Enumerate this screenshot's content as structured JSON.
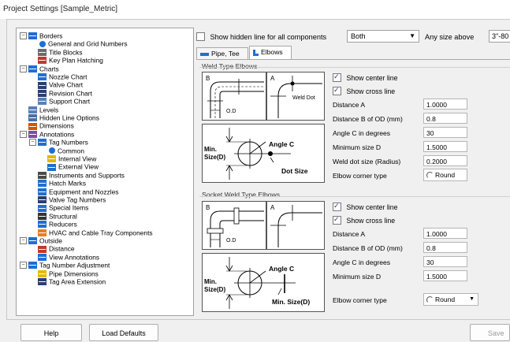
{
  "window": {
    "title": "Project Settings [Sample_Metric]"
  },
  "toolbar": {
    "show_hidden_label": "Show hidden line for all components",
    "show_hidden_checked": false,
    "hidden_select_value": "Both",
    "any_size_label": "Any size above",
    "any_size_value": "3\"-80"
  },
  "tabs": [
    {
      "label": "Pipe, Tee",
      "active": false
    },
    {
      "label": "Elbows",
      "active": true
    }
  ],
  "tree": [
    {
      "label": "Borders",
      "icon": "borders-icon",
      "exp": "−"
    },
    {
      "label": "General and Grid Numbers",
      "icon": "circle-icon"
    },
    {
      "label": "Title Blocks",
      "icon": "title-blocks-icon"
    },
    {
      "label": "Key Plan Hatching",
      "icon": "key-plan-icon"
    },
    {
      "label": "Charts",
      "icon": "charts-icon",
      "exp": "−"
    },
    {
      "label": "Nozzle Chart",
      "icon": "nozzle-chart-icon"
    },
    {
      "label": "Valve Chart",
      "icon": "valve-chart-icon"
    },
    {
      "label": "Revision Chart",
      "icon": "revision-chart-icon"
    },
    {
      "label": "Support Chart",
      "icon": "support-chart-icon"
    },
    {
      "label": "Levels",
      "icon": "levels-icon"
    },
    {
      "label": "Hidden Line Options",
      "icon": "hidden-line-icon"
    },
    {
      "label": "Dimensions",
      "icon": "dimensions-icon"
    },
    {
      "label": "Annotations",
      "icon": "annotations-icon",
      "exp": "−"
    },
    {
      "label": "Tag Numbers",
      "icon": "tag-icon",
      "exp": "−"
    },
    {
      "label": "Common",
      "icon": "circle-icon"
    },
    {
      "label": "Internal View",
      "icon": "internal-view-icon"
    },
    {
      "label": "External View",
      "icon": "external-view-icon"
    },
    {
      "label": "Instruments and Supports",
      "icon": "instruments-icon"
    },
    {
      "label": "Hatch Marks",
      "icon": "hatch-marks-icon"
    },
    {
      "label": "Equipment and Nozzles",
      "icon": "equipment-icon"
    },
    {
      "label": "Valve Tag Numbers",
      "icon": "valve-tag-icon"
    },
    {
      "label": "Special Items",
      "icon": "special-items-icon"
    },
    {
      "label": "Structural",
      "icon": "structural-icon"
    },
    {
      "label": "Reducers",
      "icon": "reducers-icon"
    },
    {
      "label": "HVAC and Cable Tray Components",
      "icon": "hvac-icon"
    },
    {
      "label": "Outside",
      "icon": "outside-icon",
      "exp": "−"
    },
    {
      "label": "Distance",
      "icon": "distance-icon"
    },
    {
      "label": "View Annotations",
      "icon": "view-annotations-icon"
    },
    {
      "label": "Tag Number Adjustment",
      "icon": "tag-icon",
      "exp": "−"
    },
    {
      "label": "Pipe Dimensions",
      "icon": "pipe-dimensions-icon"
    },
    {
      "label": "Tag Area Extension",
      "icon": "tag-area-icon"
    }
  ],
  "weld": {
    "group_title": "Weld Type Elbows",
    "show_center_line": "Show center line",
    "show_center_checked": true,
    "show_cross_line": "Show cross line",
    "show_cross_checked": true,
    "distance_a_label": "Distance A",
    "distance_a_value": "1.0000",
    "distance_b_label": "Distance B of OD (mm)",
    "distance_b_value": "0.8",
    "angle_c_label": "Angle C in degrees",
    "angle_c_value": "30",
    "min_size_label": "Minimum size D",
    "min_size_value": "1.5000",
    "weld_dot_label": "Weld dot size (Radius)",
    "weld_dot_value": "0.2000",
    "corner_label": "Elbow corner type",
    "corner_value": "Round",
    "sketch": {
      "b": "B",
      "a": "A",
      "od": "O.D",
      "weld_dot": "Weld Dot",
      "min_size": "Min.",
      "size_d": "Size(D)",
      "angle_c": "Angle C",
      "dot_size": "Dot Size"
    }
  },
  "socket": {
    "group_title": "Socket Weld Type Elbows",
    "show_center_line": "Show center line",
    "show_center_checked": true,
    "show_cross_line": "Show cross line",
    "show_cross_checked": true,
    "distance_a_label": "Distance A",
    "distance_a_value": "1.0000",
    "distance_b_label": "Distance B of OD (mm)",
    "distance_b_value": "0.8",
    "angle_c_label": "Angle C in degrees",
    "angle_c_value": "30",
    "min_size_label": "Minimum size D",
    "min_size_value": "1.5000",
    "corner_label": "Elbow corner type",
    "corner_value": "Round",
    "sketch": {
      "b": "B",
      "a": "A",
      "od": "O.D",
      "min_size": "Min.",
      "size_d": "Size(D)",
      "angle_c": "Angle C",
      "min_size_d": "Min. Size(D)"
    }
  },
  "footer": {
    "help": "Help",
    "load_defaults": "Load Defaults",
    "save": "Save"
  },
  "colors": {
    "accent": "#1f6fd1",
    "tree_border": "#a0a0a0"
  }
}
